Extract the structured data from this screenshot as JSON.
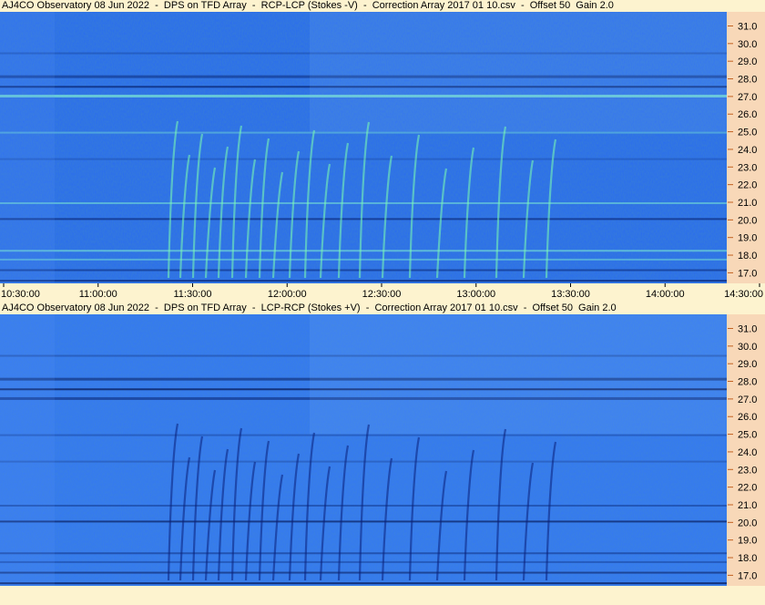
{
  "panels": [
    {
      "title": "AJ4CO Observatory 08 Jun 2022  -  DPS on TFD Array  -  RCP-LCP (Stokes -V)  -  Correction Array 2017 01 10.csv  -  Offset 50  Gain 2.0",
      "polarity": "positive",
      "background_color": "#2a6cf0",
      "emission_color": "#7cffb0"
    },
    {
      "title": "AJ4CO Observatory 08 Jun 2022  -  DPS on TFD Array  -  LCP-RCP (Stokes +V)  -  Correction Array 2017 01 10.csv  -  Offset 50  Gain 2.0",
      "polarity": "negative",
      "background_color": "#3478f4",
      "emission_color": "#0a1f7a"
    }
  ],
  "chart_data": {
    "type": "heatmap",
    "x_ticks": [
      "10:30:00",
      "11:00:00",
      "11:30:00",
      "12:00:00",
      "12:30:00",
      "13:00:00",
      "13:30:00",
      "14:00:00",
      "14:30:00"
    ],
    "y_ticks": [
      "31.0",
      "30.0",
      "29.0",
      "28.0",
      "27.0",
      "26.0",
      "25.0",
      "24.0",
      "23.0",
      "22.0",
      "21.0",
      "20.0",
      "19.0",
      "18.0",
      "17.0"
    ],
    "xlim": [
      "10:30:00",
      "14:30:00"
    ],
    "ylim_mhz": [
      16.4,
      31.8
    ],
    "colors": {
      "axis_background": "#fdf3cf",
      "freq_axis_background": "#f8d8b8",
      "tick_color": "#c06020"
    }
  }
}
